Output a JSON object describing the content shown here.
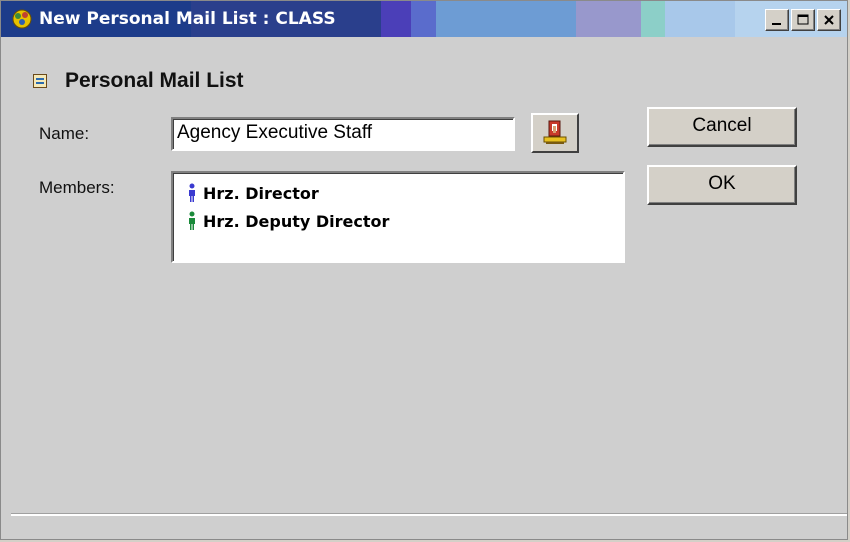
{
  "window": {
    "title": "New Personal Mail List : CLASS",
    "titlebar_colors": [
      "#1d3c8a",
      "#1e3f90",
      "#5a4fc0",
      "#4c6fc8",
      "#6e9ed6",
      "#9a9ed2",
      "#8fd0c8",
      "#a9c9ea",
      "#b7d5ef"
    ],
    "controls": {
      "minimize": "minimize",
      "maximize": "maximize",
      "close": "close"
    }
  },
  "form": {
    "heading": "Personal Mail List",
    "name_label": "Name:",
    "name_value": "Agency Executive Staff",
    "members_label": "Members:",
    "members": [
      {
        "name": "Hrz. Director",
        "icon": "person-icon",
        "icon_color": "#3a3ad0"
      },
      {
        "name": "Hrz. Deputy Director",
        "icon": "person-icon",
        "icon_color": "#1a8a3a"
      }
    ],
    "address_book_icon": "address-book-icon"
  },
  "buttons": {
    "cancel": "Cancel",
    "ok": "OK"
  }
}
